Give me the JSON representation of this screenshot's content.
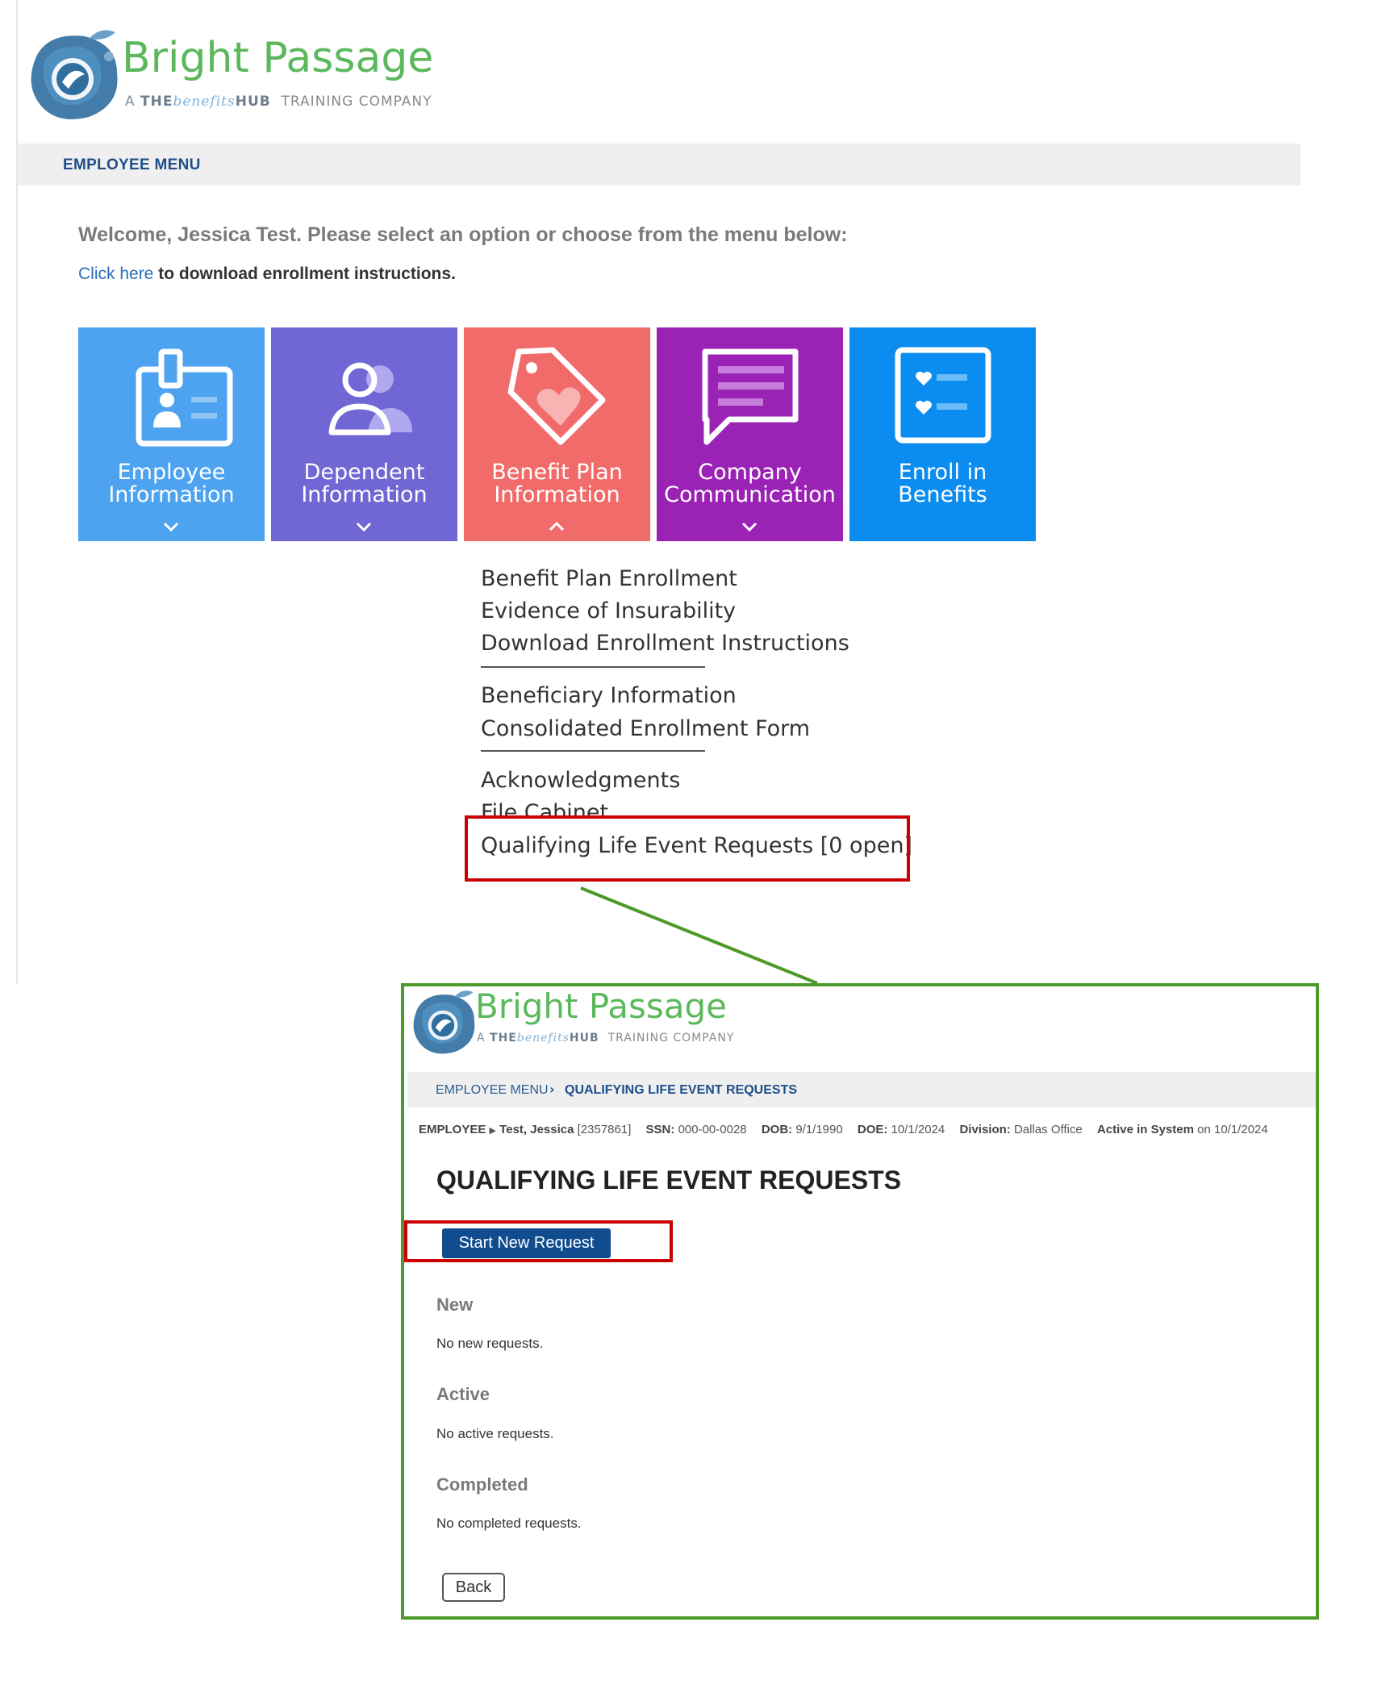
{
  "colors": {
    "brand_green": "#5cb85c",
    "nav_blue": "#1e4f8a",
    "link_blue": "#2a6ebb",
    "highlight_red": "#cc0000",
    "callout_green": "#4d9a2a",
    "button_blue": "#114c8f",
    "tile_employee": "#4da3f0",
    "tile_dependent": "#7066d4",
    "tile_benefit": "#f26b6b",
    "tile_company": "#9a22b5",
    "tile_enroll": "#0b8cf0"
  },
  "logo": {
    "name": "Bright Passage",
    "tag_a": "A",
    "tag_the": "THE",
    "tag_benefits": "benefits",
    "tag_hub": "HUB",
    "tag_suffix": "TRAINING COMPANY"
  },
  "top": {
    "nav_label": "EMPLOYEE MENU",
    "welcome": "Welcome, Jessica Test. Please select an option or choose from the menu below:",
    "instructions_link": "Click here",
    "instructions_text": " to download enrollment instructions.",
    "tiles": [
      {
        "line1": "Employee",
        "line2": "Information",
        "chevron": "chevron-down-icon",
        "icon": "id-badge-icon"
      },
      {
        "line1": "Dependent",
        "line2": "Information",
        "chevron": "chevron-down-icon",
        "icon": "users-icon"
      },
      {
        "line1": "Benefit Plan",
        "line2": "Information",
        "chevron": "chevron-up-icon",
        "icon": "heart-tag-icon"
      },
      {
        "line1": "Company",
        "line2": "Communication",
        "chevron": "chevron-down-icon",
        "icon": "message-icon"
      },
      {
        "line1": "Enroll in",
        "line2": "Benefits",
        "chevron": "",
        "icon": "checklist-icon"
      }
    ],
    "dropdown": [
      "Benefit Plan Enrollment",
      "Evidence of Insurability",
      "Download Enrollment Instructions",
      "Beneficiary Information",
      "Consolidated Enrollment Form",
      "Acknowledgments",
      "File Cabinet",
      "Qualifying Life Event Requests [0 open]"
    ]
  },
  "inset": {
    "breadcrumb_home": "EMPLOYEE MENU",
    "breadcrumb_current": "QUALIFYING LIFE EVENT REQUESTS",
    "employee": {
      "label": "EMPLOYEE",
      "name": "Test, Jessica",
      "id": "[2357861]",
      "ssn_label": "SSN:",
      "ssn": "000-00-0028",
      "dob_label": "DOB:",
      "dob": "9/1/1990",
      "doe_label": "DOE:",
      "doe": "10/1/2024",
      "division_label": "Division:",
      "division": "Dallas Office",
      "status_label": "Active in System",
      "status_on": "on 10/1/2024"
    },
    "title": "QUALIFYING LIFE EVENT REQUESTS",
    "start_button": "Start New Request",
    "sections": [
      {
        "heading": "New",
        "text": "No new requests."
      },
      {
        "heading": "Active",
        "text": "No active requests."
      },
      {
        "heading": "Completed",
        "text": "No completed requests."
      }
    ],
    "back_button": "Back"
  }
}
